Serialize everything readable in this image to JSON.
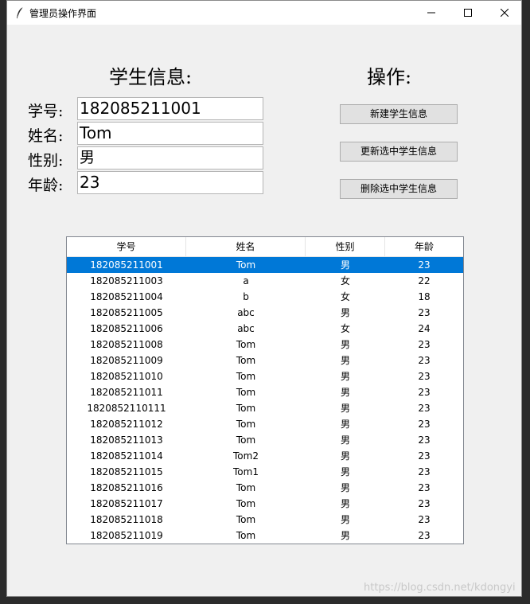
{
  "window": {
    "title": "管理员操作界面"
  },
  "form": {
    "heading": "学生信息:",
    "fields": [
      {
        "label": "学号:",
        "value": "182085211001"
      },
      {
        "label": "姓名:",
        "value": "Tom"
      },
      {
        "label": "性别:",
        "value": "男"
      },
      {
        "label": "年龄:",
        "value": "23"
      }
    ]
  },
  "actions": {
    "heading": "操作:",
    "new_label": "新建学生信息",
    "update_label": "更新选中学生信息",
    "delete_label": "删除选中学生信息"
  },
  "table": {
    "columns": [
      "学号",
      "姓名",
      "性别",
      "年龄"
    ],
    "selected_row": 0,
    "rows": [
      [
        "182085211001",
        "Tom",
        "男",
        "23"
      ],
      [
        "182085211003",
        "a",
        "女",
        "22"
      ],
      [
        "182085211004",
        "b",
        "女",
        "18"
      ],
      [
        "182085211005",
        "abc",
        "男",
        "23"
      ],
      [
        "182085211006",
        "abc",
        "女",
        "24"
      ],
      [
        "182085211008",
        "Tom",
        "男",
        "23"
      ],
      [
        "182085211009",
        "Tom",
        "男",
        "23"
      ],
      [
        "182085211010",
        "Tom",
        "男",
        "23"
      ],
      [
        "182085211011",
        "Tom",
        "男",
        "23"
      ],
      [
        "1820852110111",
        "Tom",
        "男",
        "23"
      ],
      [
        "182085211012",
        "Tom",
        "男",
        "23"
      ],
      [
        "182085211013",
        "Tom",
        "男",
        "23"
      ],
      [
        "182085211014",
        "Tom2",
        "男",
        "23"
      ],
      [
        "182085211015",
        "Tom1",
        "男",
        "23"
      ],
      [
        "182085211016",
        "Tom",
        "男",
        "23"
      ],
      [
        "182085211017",
        "Tom",
        "男",
        "23"
      ],
      [
        "182085211018",
        "Tom",
        "男",
        "23"
      ],
      [
        "182085211019",
        "Tom",
        "男",
        "23"
      ]
    ]
  },
  "watermark": "https://blog.csdn.net/kdongyi",
  "colors": {
    "selection": "#0078d7",
    "window_bg": "#f0f0f0",
    "editor_bg": "#2b2b2b"
  }
}
